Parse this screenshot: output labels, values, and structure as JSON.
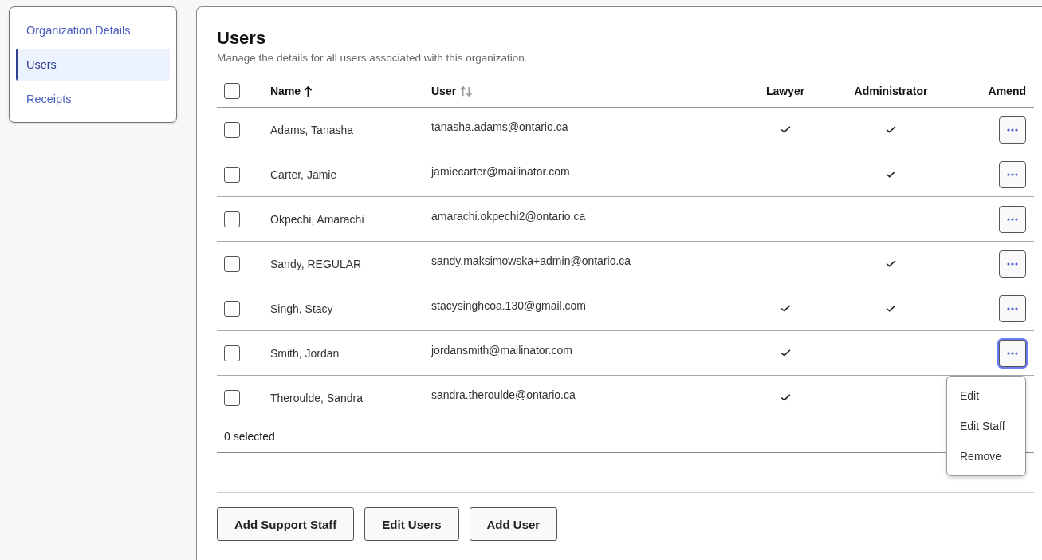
{
  "sidebar": {
    "items": [
      {
        "label": "Organization Details",
        "selected": false
      },
      {
        "label": "Users",
        "selected": true
      },
      {
        "label": "Receipts",
        "selected": false
      }
    ]
  },
  "page": {
    "title": "Users",
    "subtitle": "Manage the details for all users associated with this organization."
  },
  "table": {
    "select_all": {
      "checked": false
    },
    "columns": [
      {
        "label": "Name",
        "sort_active": true
      },
      {
        "label": "User",
        "sort_active": false
      },
      {
        "label": "Lawyer"
      },
      {
        "label": "Administrator"
      },
      {
        "label": "Amend"
      }
    ],
    "rows": [
      {
        "checked": false,
        "name": "Adams, Tanasha",
        "user": "tanasha.adams@ontario.ca",
        "lawyer": true,
        "administrator": true,
        "menu_open": false
      },
      {
        "checked": false,
        "name": "Carter, Jamie",
        "user": "jamiecarter@mailinator.com",
        "lawyer": false,
        "administrator": true,
        "menu_open": false
      },
      {
        "checked": false,
        "name": "Okpechi, Amarachi",
        "user": "amarachi.okpechi2@ontario.ca",
        "lawyer": false,
        "administrator": false,
        "menu_open": false
      },
      {
        "checked": false,
        "name": "Sandy, REGULAR",
        "user": "sandy.maksimowska+admin@ontario.ca",
        "lawyer": false,
        "administrator": true,
        "menu_open": false
      },
      {
        "checked": false,
        "name": "Singh, Stacy",
        "user": "stacysinghcoa.130@gmail.com",
        "lawyer": true,
        "administrator": true,
        "menu_open": false
      },
      {
        "checked": false,
        "name": "Smith, Jordan",
        "user": "jordansmith@mailinator.com",
        "lawyer": true,
        "administrator": false,
        "menu_open": true
      },
      {
        "checked": false,
        "name": "Theroulde, Sandra",
        "user": "sandra.theroulde@ontario.ca",
        "lawyer": true,
        "administrator": false,
        "menu_open": false
      }
    ],
    "selection_count": "0 selected"
  },
  "row_menu": {
    "items": [
      "Edit",
      "Edit Staff",
      "Remove"
    ]
  },
  "buttons": [
    "Add Support Staff",
    "Edit Users",
    "Add User"
  ]
}
